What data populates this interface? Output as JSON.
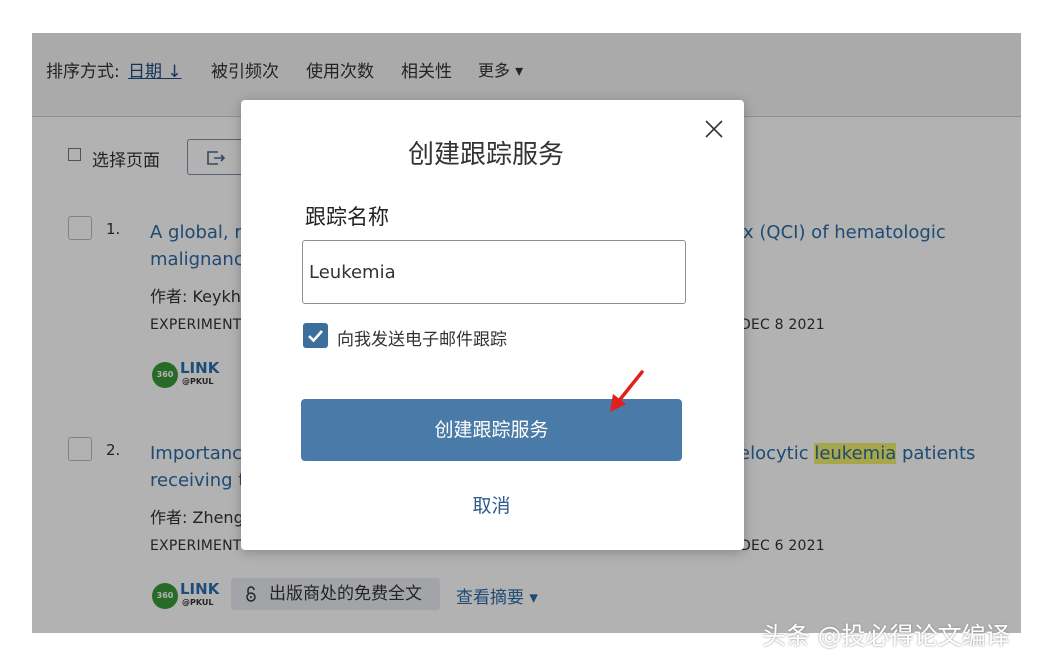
{
  "sort_bar": {
    "label": "排序方式:",
    "date": "日期 ↓",
    "cited": "被引频次",
    "usage": "使用次数",
    "relevance": "相关性",
    "more": "更多 ▾"
  },
  "toolbar": {
    "select_page": "选择页面"
  },
  "records": [
    {
      "num": "1.",
      "title_line1_left": "A global, reg",
      "title_line1_right": "x (QCI) of hematologic",
      "title_line2": "malignancie",
      "authors_prefix": "作者: Keykha",
      "source_left": "EXPERIMENT",
      "source_right": "DEC 8 2021",
      "link_label": "LINK",
      "link_sub": "@PKUL",
      "badge_360": "360"
    },
    {
      "num": "2.",
      "title_line1_left": "Importance",
      "title_line1_right_pre": "elocytic ",
      "title_line1_right_hl": "leukemia",
      "title_line1_right_post": " patients",
      "title_line2": "receiving th",
      "authors_prefix": "作者: Zheng,",
      "source_left": "EXPERIMENT",
      "source_right": "DEC 6 2021",
      "link_label": "LINK",
      "link_sub": "@PKUL",
      "badge_360": "360",
      "fulltext": "出版商处的免费全文",
      "abstract": "查看摘要 ▾"
    }
  ],
  "modal": {
    "title": "创建跟踪服务",
    "field_label": "跟踪名称",
    "input_value": "Leukemia",
    "email_checkbox_label": "向我发送电子邮件跟踪",
    "email_checked": true,
    "create_button": "创建跟踪服务",
    "cancel": "取消"
  },
  "watermark": "头条 @投必得论文编译",
  "colors": {
    "primary_button": "#4a7aa7",
    "link": "#2d6aa6",
    "highlight": "#f0ee6a",
    "arrow": "#e0201b"
  }
}
